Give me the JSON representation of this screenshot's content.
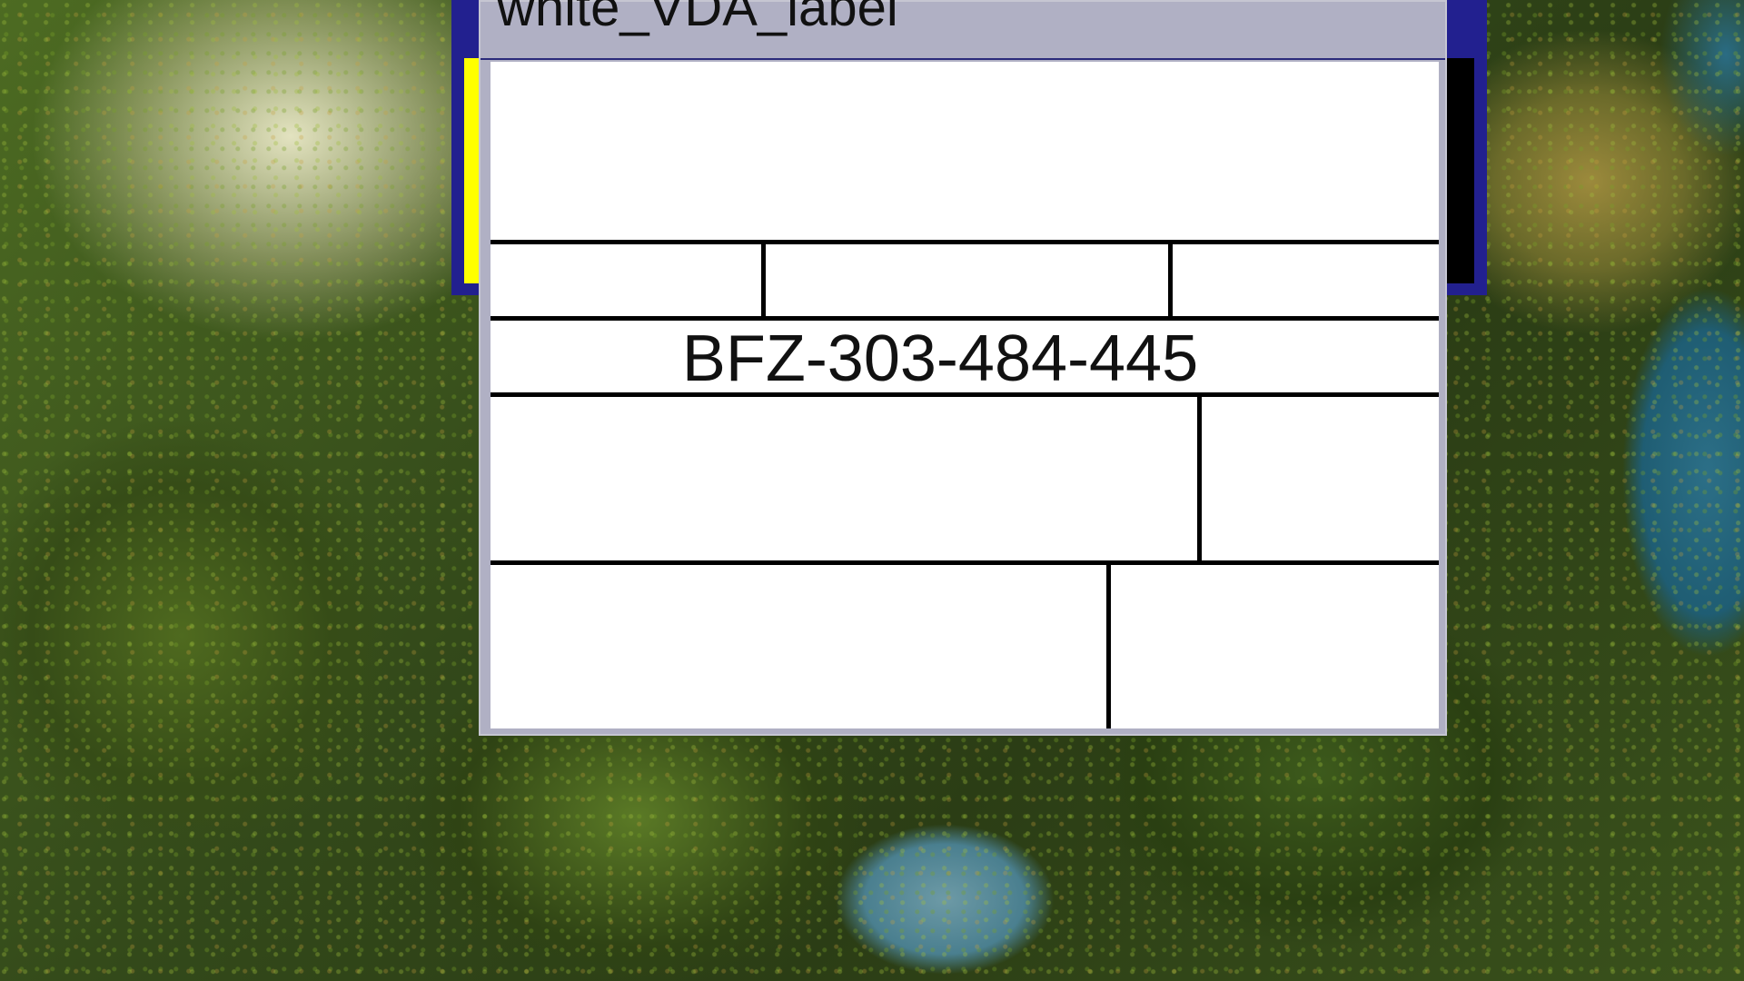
{
  "desktop": {
    "wallpaper": "aerial-tropical-island"
  },
  "back_window": {
    "frame_color": "#22208f",
    "accent_color": "#ffff00"
  },
  "front_window": {
    "title": "white_VDA_label",
    "frame_color": "#b0b0c4"
  },
  "label": {
    "code": "BFZ-303-484-445"
  }
}
